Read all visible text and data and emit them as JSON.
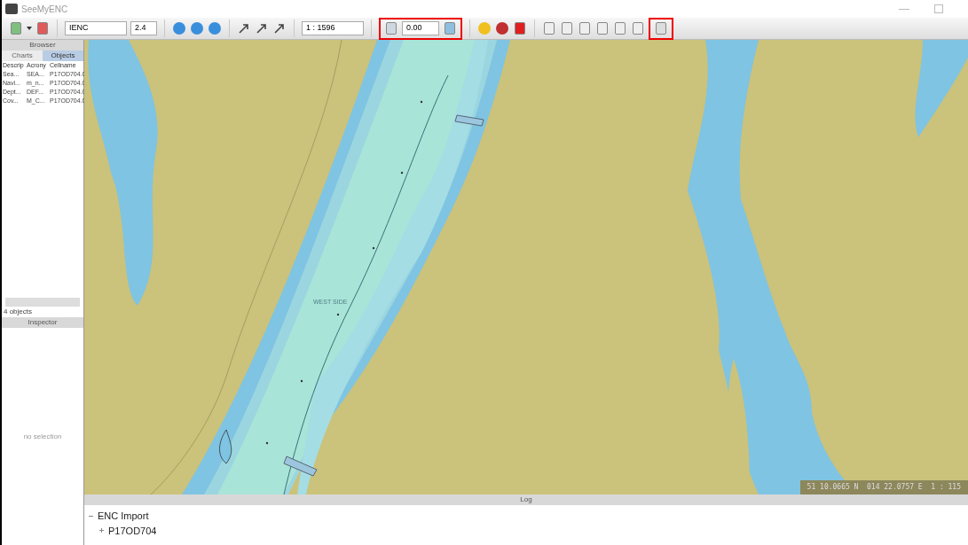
{
  "window": {
    "title": "SeeMyENC"
  },
  "toolbar": {
    "chart_type": "IENC",
    "version": "2.4",
    "scale": "1 : 1596",
    "depth": "0.00"
  },
  "browser": {
    "title": "Browser",
    "tabs": [
      {
        "label": "Charts",
        "selected": false
      },
      {
        "label": "Objects",
        "selected": true
      }
    ],
    "columns": [
      "Descrip",
      "Acrony",
      "Cellname"
    ],
    "rows": [
      [
        "Sea...",
        "SEA...",
        "P17OD704.0"
      ],
      [
        "Navi...",
        "m_n...",
        "P17OD704.0"
      ],
      [
        "Dept...",
        "DEF...",
        "P17OD704.0"
      ],
      [
        "Cov...",
        "M_C...",
        "P17OD704.0"
      ]
    ],
    "count": "4 objects"
  },
  "inspector": {
    "title": "Inspector",
    "empty": "no selection"
  },
  "map": {
    "label": "WEST SIDE",
    "status": "51 10.0665 N  014 22.0757 E  1 : 115"
  },
  "log": {
    "title": "Log",
    "tree": [
      {
        "label": "ENC Import",
        "expanded": true,
        "children": [
          {
            "label": "P17OD704",
            "expanded": false
          }
        ]
      }
    ]
  }
}
